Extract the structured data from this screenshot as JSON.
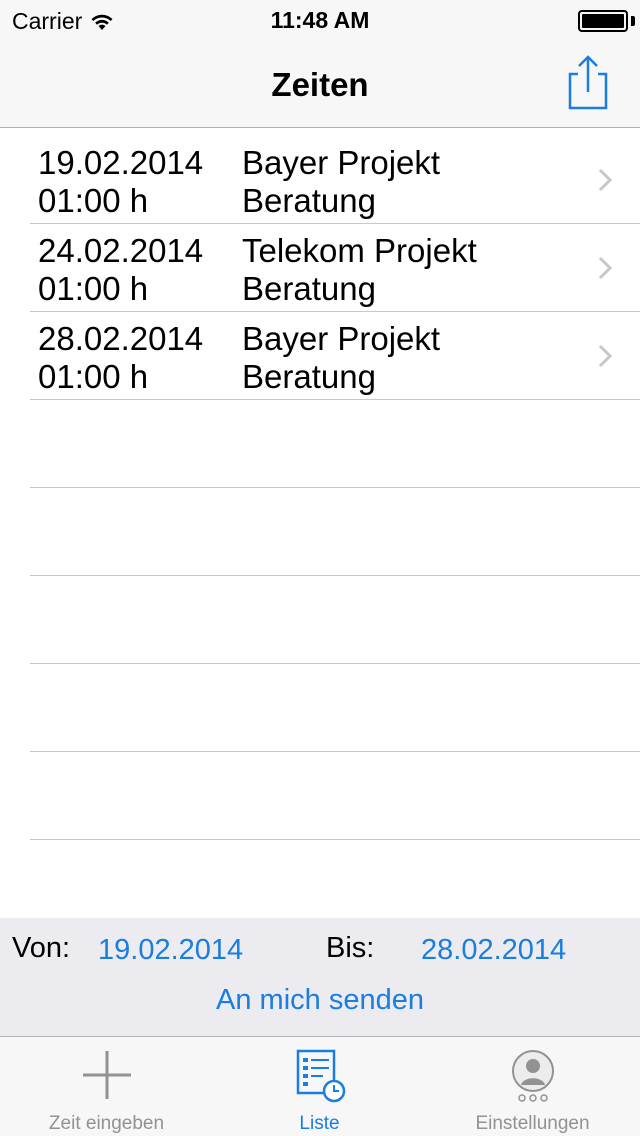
{
  "status_bar": {
    "carrier": "Carrier",
    "time": "11:48 AM"
  },
  "nav": {
    "title": "Zeiten",
    "share_icon": "share-icon"
  },
  "entries": [
    {
      "date": "19.02.2014",
      "duration": "01:00 h",
      "project": "Bayer Projekt",
      "activity": "Beratung"
    },
    {
      "date": "24.02.2014",
      "duration": "01:00 h",
      "project": "Telekom Projekt",
      "activity": "Beratung"
    },
    {
      "date": "28.02.2014",
      "duration": "01:00 h",
      "project": "Bayer Projekt",
      "activity": "Beratung"
    }
  ],
  "filter": {
    "von_label": "Von:",
    "von_value": "19.02.2014",
    "bis_label": "Bis:",
    "bis_value": "28.02.2014",
    "send_label": "An mich senden"
  },
  "tabs": [
    {
      "label": "Zeit eingeben",
      "icon": "plus-icon",
      "active": false
    },
    {
      "label": "Liste",
      "icon": "list-clock-icon",
      "active": true
    },
    {
      "label": "Einstellungen",
      "icon": "user-settings-icon",
      "active": false
    }
  ],
  "colors": {
    "accent": "#1a7de0",
    "tab_inactive": "#929292",
    "bar_bg": "#f7f7f7",
    "filter_bg": "#ebebf0"
  }
}
